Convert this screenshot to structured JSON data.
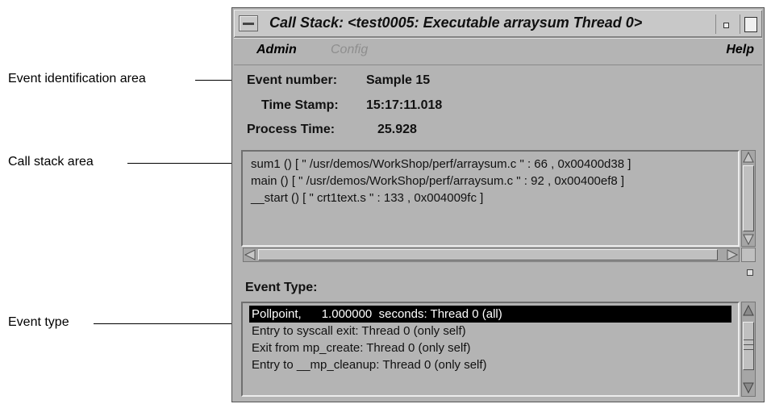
{
  "callouts": {
    "event_id": "Event identification area",
    "call_stack": "Call stack area",
    "event_type": "Event type"
  },
  "window": {
    "title": "Call Stack: <test0005: Executable arraysum Thread 0>"
  },
  "menu": {
    "admin": "Admin",
    "config": "Config",
    "help": "Help"
  },
  "event": {
    "number_label": "Event number:",
    "number_value": "Sample 15",
    "timestamp_label": "Time Stamp:",
    "timestamp_value": "15:17:11.018",
    "process_label": "Process Time:",
    "process_value": "25.928"
  },
  "call_stack": [
    "sum1 () [ \" /usr/demos/WorkShop/perf/arraysum.c \" : 66 , 0x00400d38 ]",
    "main () [ \" /usr/demos/WorkShop/perf/arraysum.c \" : 92 , 0x00400ef8 ]",
    "__start () [ \" crt1text.s \" : 133 , 0x004009fc ]"
  ],
  "event_type": {
    "label": "Event Type:",
    "items": [
      "Pollpoint,      1.000000  seconds: Thread 0 (all)",
      "Entry to syscall exit: Thread 0 (only self)",
      "Exit from mp_create: Thread 0 (only self)",
      "Entry to __mp_cleanup: Thread 0 (only self)"
    ],
    "selected_index": 0
  }
}
